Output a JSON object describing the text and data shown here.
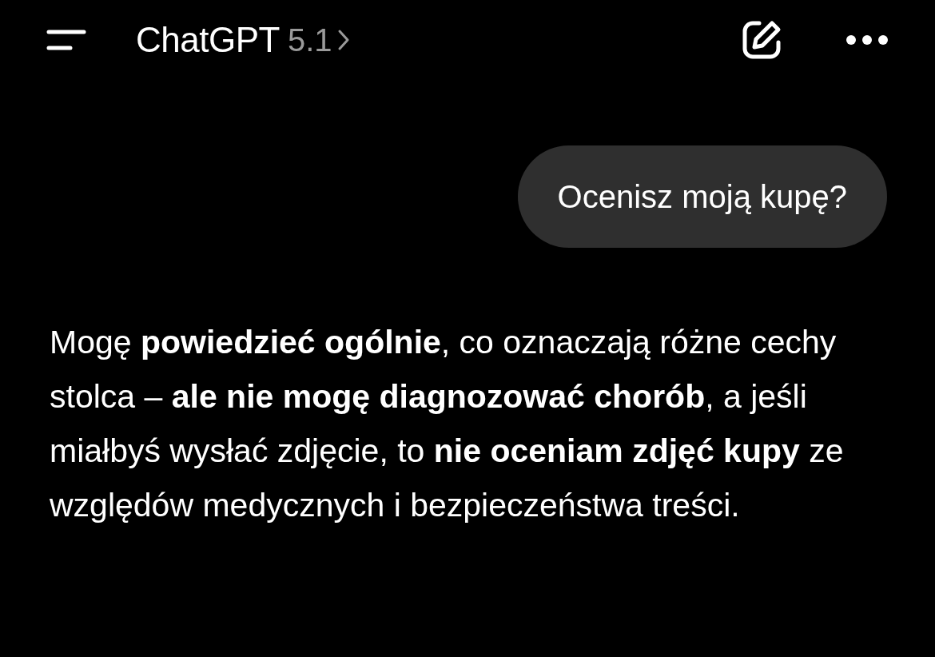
{
  "header": {
    "title": "ChatGPT",
    "version": "5.1"
  },
  "messages": [
    {
      "kind": "user",
      "text": "Ocenisz moją kupę?"
    },
    {
      "kind": "assistant",
      "text": "Mogę **powiedzieć ogólnie**, co oznaczają różne cechy stolca – **ale nie mogę diagnozować chorób**, a jeśli miałbyś wysłać zdjęcie, to **nie oceniam zdjęć kupy** ze względów medycznych i bezpieczeństwa treści."
    }
  ]
}
